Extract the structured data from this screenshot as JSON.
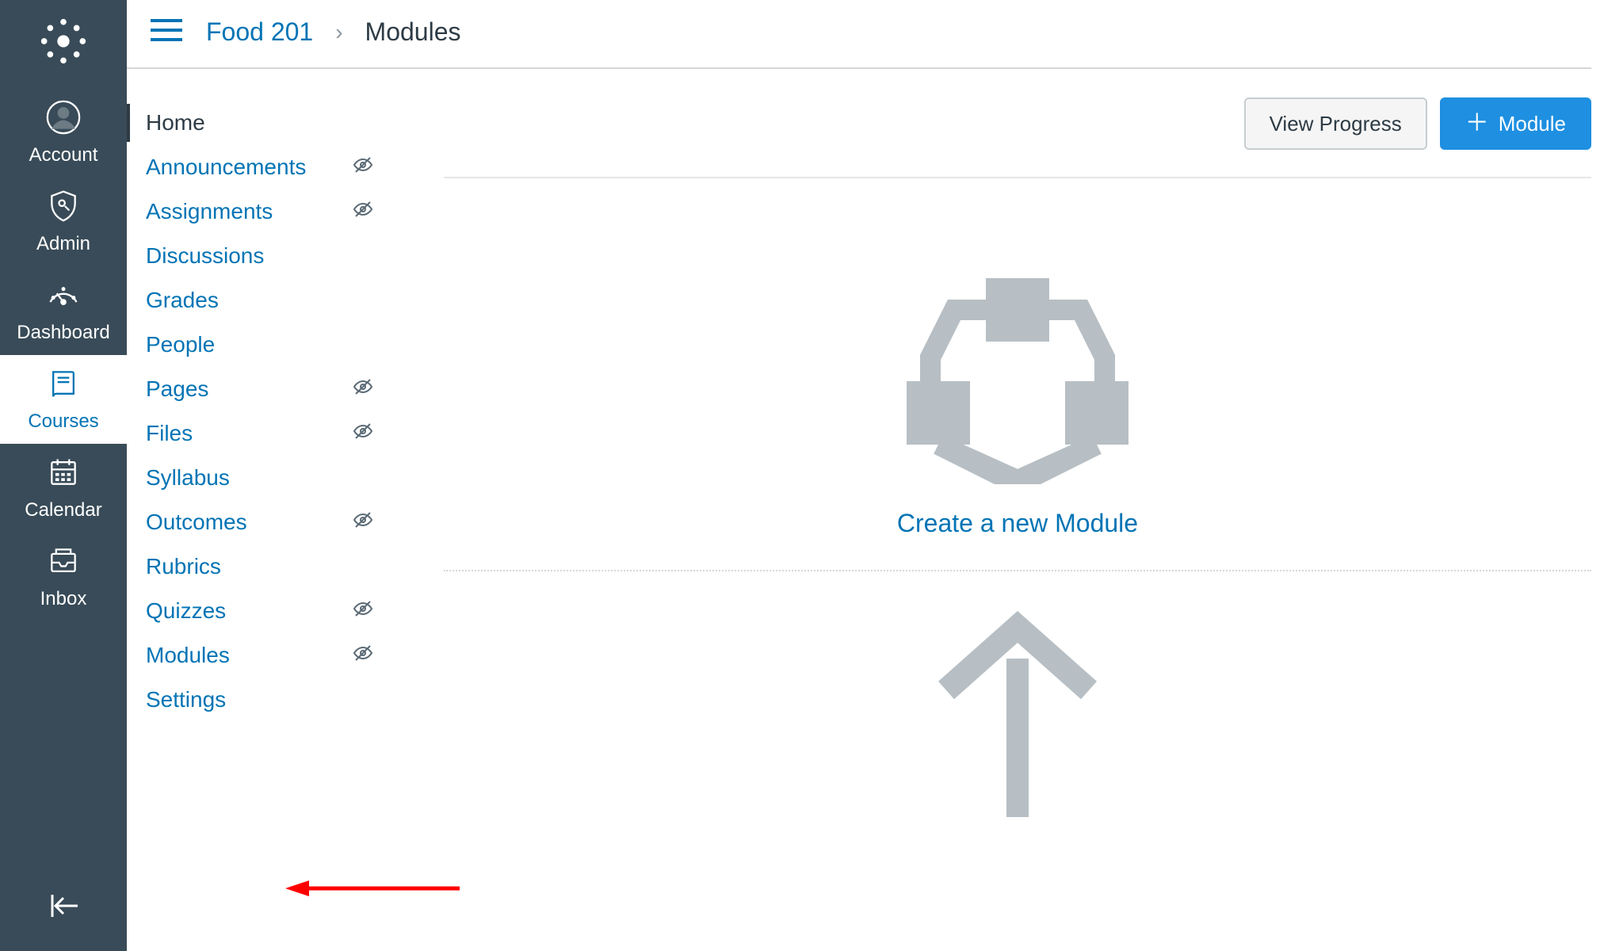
{
  "globalNav": {
    "items": [
      {
        "key": "account",
        "label": "Account"
      },
      {
        "key": "admin",
        "label": "Admin"
      },
      {
        "key": "dashboard",
        "label": "Dashboard"
      },
      {
        "key": "courses",
        "label": "Courses",
        "active": true
      },
      {
        "key": "calendar",
        "label": "Calendar"
      },
      {
        "key": "inbox",
        "label": "Inbox"
      }
    ]
  },
  "breadcrumb": {
    "course": "Food 201",
    "current": "Modules"
  },
  "courseNav": {
    "items": [
      {
        "label": "Home",
        "current": true
      },
      {
        "label": "Announcements",
        "hidden": true
      },
      {
        "label": "Assignments",
        "hidden": true
      },
      {
        "label": "Discussions"
      },
      {
        "label": "Grades"
      },
      {
        "label": "People"
      },
      {
        "label": "Pages",
        "hidden": true
      },
      {
        "label": "Files",
        "hidden": true
      },
      {
        "label": "Syllabus"
      },
      {
        "label": "Outcomes",
        "hidden": true
      },
      {
        "label": "Rubrics"
      },
      {
        "label": "Quizzes",
        "hidden": true
      },
      {
        "label": "Modules",
        "hidden": true
      },
      {
        "label": "Settings"
      }
    ]
  },
  "actions": {
    "viewProgress": "View Progress",
    "addModule": "Module"
  },
  "emptyState": {
    "caption": "Create a new Module"
  },
  "colors": {
    "link": "#0374b5",
    "primary": "#1e8fe1",
    "navBg": "#394b58"
  }
}
